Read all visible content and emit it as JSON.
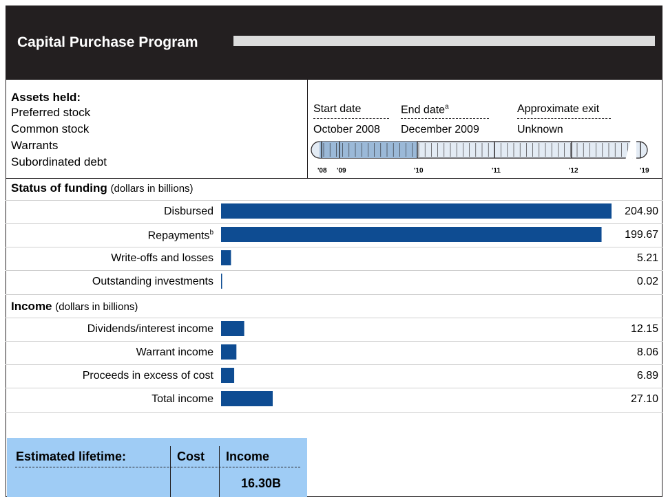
{
  "header": {
    "title": "Capital Purchase Program"
  },
  "assets": {
    "heading": "Assets held:",
    "items": [
      "Preferred stock",
      "Common stock",
      "Warrants",
      "Subordinated debt"
    ]
  },
  "timeline": {
    "start_label": "Start date",
    "start_value": "October 2008",
    "end_label": "End date",
    "end_note": "a",
    "end_value": "December 2009",
    "exit_label": "Approximate exit",
    "exit_value": "Unknown",
    "ticks": [
      "'08",
      "'09",
      "'10",
      "'11",
      "'12",
      "'19"
    ]
  },
  "funding": {
    "title": "Status of funding",
    "unit": "(dollars in billions)"
  },
  "income": {
    "title": "Income",
    "unit": "(dollars in billions)"
  },
  "lifetime": {
    "label": "Estimated lifetime:",
    "cost_header": "Cost",
    "income_header": "Income",
    "income_value": "16.30B"
  },
  "colors": {
    "bar": "#0e4c92",
    "header": "#231f20",
    "timeline_active": "#9bb9d8",
    "timeline_future": "#e3ebf4",
    "lifetime_box": "#9fccf5"
  },
  "chart_data": [
    {
      "type": "bar",
      "title": "Status of funding",
      "categories": [
        "Disbursed",
        "Repayments",
        "Write-offs and losses",
        "Outstanding investments"
      ],
      "category_notes": [
        "",
        "b",
        "",
        ""
      ],
      "values": [
        204.9,
        199.67,
        5.21,
        0.02
      ],
      "value_labels": [
        "204.90",
        "199.67",
        "5.21",
        "0.02"
      ],
      "xlim": [
        0,
        204.9
      ]
    },
    {
      "type": "bar",
      "title": "Income",
      "categories": [
        "Dividends/interest income",
        "Warrant income",
        "Proceeds in excess of cost",
        "Total income"
      ],
      "values": [
        12.15,
        8.06,
        6.89,
        27.1
      ],
      "value_labels": [
        "12.15",
        "8.06",
        "6.89",
        "27.10"
      ],
      "xlim": [
        0,
        204.9
      ]
    }
  ]
}
